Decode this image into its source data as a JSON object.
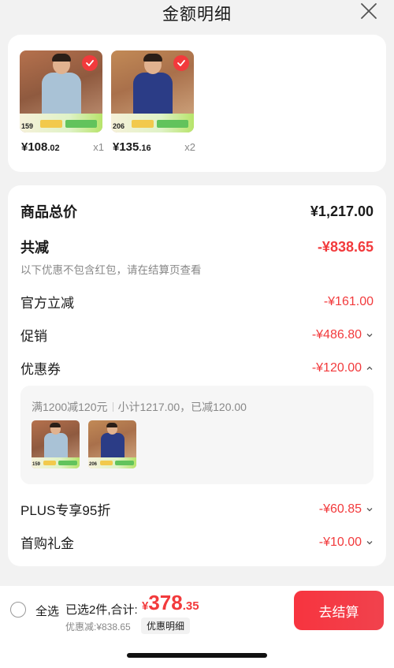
{
  "header": {
    "title": "金额明细",
    "close_icon": "close-icon"
  },
  "products": [
    {
      "thumb_price": "159",
      "price_int": "¥108",
      "price_dec": ".02",
      "qty": "x1",
      "color": "#a9c2d6"
    },
    {
      "thumb_price": "206",
      "price_int": "¥135",
      "price_dec": ".16",
      "qty": "x2",
      "color": "#2b3c86"
    }
  ],
  "summary": {
    "total_label": "商品总价",
    "total_value": "¥1,217.00",
    "reduce_label": "共减",
    "reduce_value": "-¥838.65",
    "note": "以下优惠不包含红包，请在结算页查看"
  },
  "discounts": {
    "official_label": "官方立减",
    "official_value": "-¥161.00",
    "promo_label": "促销",
    "promo_value": "-¥486.80",
    "coupon_label": "优惠券",
    "coupon_value": "-¥120.00",
    "plus_label": "PLUS专享95折",
    "plus_value": "-¥60.85",
    "first_label": "首购礼金",
    "first_value": "-¥10.00"
  },
  "coupon_detail": {
    "rule": "满1200减120元",
    "subtotal": "小计1217.00，已减120.00"
  },
  "bottom": {
    "select_all": "全选",
    "selected": "已选2件,合计:",
    "currency": "¥",
    "total_int": "378",
    "total_dec": ".35",
    "discount_line": "优惠减:¥838.65",
    "detail_btn": "优惠明细",
    "checkout": "去结算"
  },
  "colors": {
    "accent": "#f23a3c",
    "background": "#f2f2f2"
  }
}
